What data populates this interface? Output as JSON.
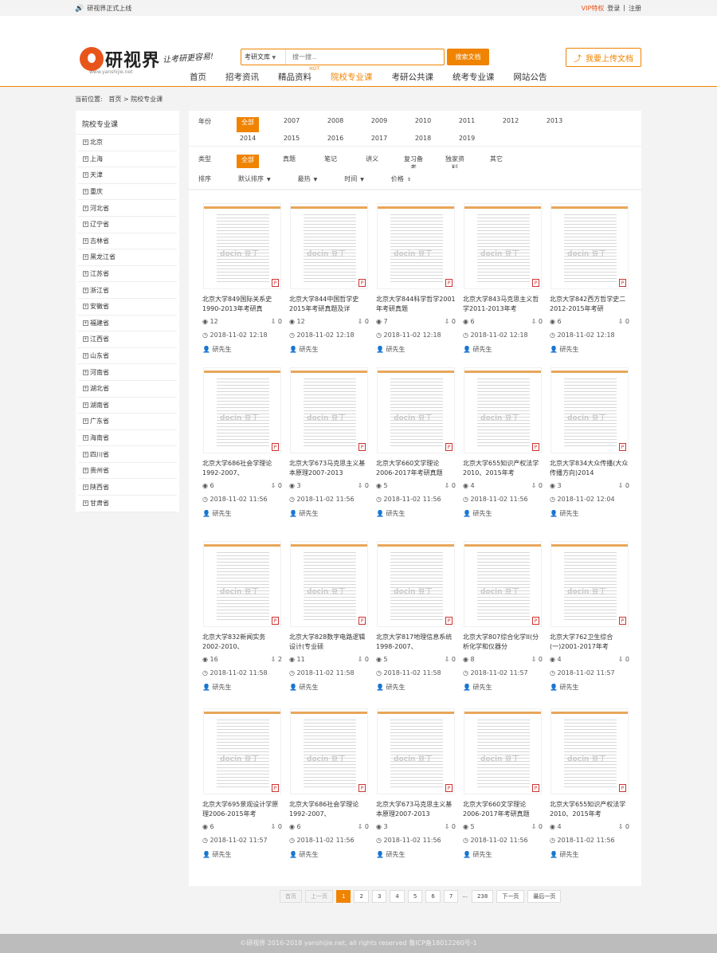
{
  "topbar": {
    "notice": "研视界正式上线",
    "vip": "VIP特权",
    "login": "登录",
    "sep": "|",
    "register": "注册"
  },
  "logo": {
    "text": "研视界",
    "sub": "www.yanshijie.net",
    "slogan": "让考研更容易!"
  },
  "search": {
    "category": "考研文库",
    "placeholder": "搜一搜...",
    "button": "搜索文档"
  },
  "upload": {
    "label": "我要上传文档"
  },
  "nav": [
    {
      "label": "首页"
    },
    {
      "label": "招考资讯"
    },
    {
      "label": "精品资料",
      "badge": "HOT"
    },
    {
      "label": "院校专业课",
      "active": true
    },
    {
      "label": "考研公共课"
    },
    {
      "label": "统考专业课"
    },
    {
      "label": "网站公告"
    }
  ],
  "breadcrumb": {
    "prefix": "当前位置:",
    "home": "首页",
    "sep": ">",
    "current": "院校专业课"
  },
  "sidebar": {
    "title": "院校专业课",
    "items": [
      "北京",
      "上海",
      "天津",
      "重庆",
      "河北省",
      "辽宁省",
      "吉林省",
      "黑龙江省",
      "江苏省",
      "浙江省",
      "安徽省",
      "福建省",
      "江西省",
      "山东省",
      "河南省",
      "湖北省",
      "湖南省",
      "广东省",
      "海南省",
      "四川省",
      "贵州省",
      "陕西省",
      "甘肃省"
    ]
  },
  "filters": {
    "year_label": "年份",
    "years": [
      "全部",
      "2007",
      "2008",
      "2009",
      "2010",
      "2011",
      "2012",
      "2013",
      "2014",
      "2015",
      "2016",
      "2017",
      "2018",
      "2019"
    ],
    "type_label": "类型",
    "types": [
      "全部",
      "真题",
      "笔记",
      "讲义",
      "复习备考",
      "独家资料",
      "其它"
    ]
  },
  "sort": {
    "label": "排序",
    "options": [
      "默认排序",
      "最热",
      "时间",
      "价格"
    ]
  },
  "docs": [
    {
      "title": "北京大学849国际关系史1990-2013年考研真",
      "views": "12",
      "downloads": "0",
      "date": "2018-11-02 12:18",
      "author": "研先生"
    },
    {
      "title": "北京大学844中国哲学史2015年考研真题及详",
      "views": "12",
      "downloads": "0",
      "date": "2018-11-02 12:18",
      "author": "研先生"
    },
    {
      "title": "北京大学844科学哲学2001年考研真题",
      "views": "7",
      "downloads": "0",
      "date": "2018-11-02 12:18",
      "author": "研先生"
    },
    {
      "title": "北京大学843马克思主义哲学2011-2013年考",
      "views": "6",
      "downloads": "0",
      "date": "2018-11-02 12:18",
      "author": "研先生"
    },
    {
      "title": "北京大学842西方哲学史二2012-2015年考研",
      "views": "6",
      "downloads": "0",
      "date": "2018-11-02 12:18",
      "author": "研先生"
    },
    {
      "title": "北京大学686社会学理论1992-2007、",
      "views": "6",
      "downloads": "0",
      "date": "2018-11-02 11:56",
      "author": "研先生"
    },
    {
      "title": "北京大学673马克思主义基本原理2007-2013",
      "views": "3",
      "downloads": "0",
      "date": "2018-11-02 11:56",
      "author": "研先生"
    },
    {
      "title": "北京大学660文学理论2006-2017年考研真题",
      "views": "5",
      "downloads": "0",
      "date": "2018-11-02 11:56",
      "author": "研先生"
    },
    {
      "title": "北京大学655知识产权法学2010、2015年考",
      "views": "4",
      "downloads": "0",
      "date": "2018-11-02 11:56",
      "author": "研先生"
    },
    {
      "title": "北京大学834大众传播(大众传播方向)2014",
      "views": "3",
      "downloads": "0",
      "date": "2018-11-02 12:04",
      "author": "研先生"
    },
    {
      "title": "北京大学832新闻实务2002-2010、",
      "views": "16",
      "downloads": "2",
      "date": "2018-11-02 11:58",
      "author": "研先生"
    },
    {
      "title": "北京大学828数字电路逻辑设计(专业硕",
      "views": "11",
      "downloads": "0",
      "date": "2018-11-02 11:58",
      "author": "研先生"
    },
    {
      "title": "北京大学817地理信息系统1998-2007、",
      "views": "5",
      "downloads": "0",
      "date": "2018-11-02 11:58",
      "author": "研先生"
    },
    {
      "title": "北京大学807综合化学II(分析化学和仪器分",
      "views": "8",
      "downloads": "0",
      "date": "2018-11-02 11:57",
      "author": "研先生"
    },
    {
      "title": "北京大学762卫生综合(一)2001-2017年考",
      "views": "4",
      "downloads": "0",
      "date": "2018-11-02 11:57",
      "author": "研先生"
    },
    {
      "title": "北京大学695景观设计学原理2006-2015年考",
      "views": "6",
      "downloads": "0",
      "date": "2018-11-02 11:57",
      "author": "研先生"
    },
    {
      "title": "北京大学686社会学理论1992-2007、",
      "views": "6",
      "downloads": "0",
      "date": "2018-11-02 11:56",
      "author": "研先生"
    },
    {
      "title": "北京大学673马克思主义基本原理2007-2013",
      "views": "3",
      "downloads": "0",
      "date": "2018-11-02 11:56",
      "author": "研先生"
    },
    {
      "title": "北京大学660文学理论2006-2017年考研真题",
      "views": "5",
      "downloads": "0",
      "date": "2018-11-02 11:56",
      "author": "研先生"
    },
    {
      "title": "北京大学655知识产权法学2010、2015年考",
      "views": "4",
      "downloads": "0",
      "date": "2018-11-02 11:56",
      "author": "研先生"
    }
  ],
  "watermark": "docin 豆丁",
  "pagination": {
    "first": "首页",
    "prev": "上一页",
    "pages": [
      "1",
      "2",
      "3",
      "4",
      "5",
      "6",
      "7"
    ],
    "current": "1",
    "ellipsis": "...",
    "last_page": "238",
    "next": "下一页",
    "last": "最后一页"
  },
  "footer": "©研视界 2016-2018 yanshijie.net, all rights reserved 鲁ICP备18012260号-1",
  "colors": {
    "accent": "#f08300",
    "footer_bg": "#bcbcbc"
  }
}
